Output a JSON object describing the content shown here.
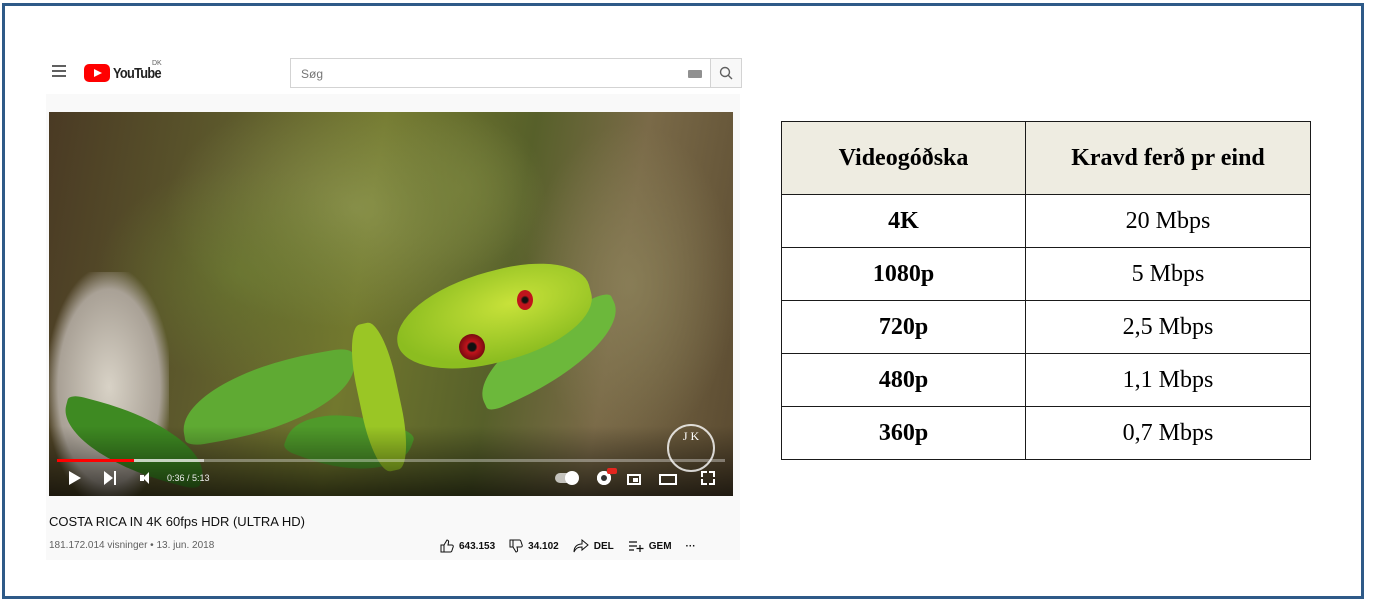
{
  "youtube": {
    "logo_text": "YouTube",
    "country_code": "DK",
    "search": {
      "placeholder": "Søg"
    },
    "player": {
      "time": "0:36 / 5:13",
      "progress": 0.115,
      "buffered": 0.22
    },
    "video": {
      "title": "COSTA RICA IN 4K 60fps HDR (ULTRA HD)",
      "meta": "181.172.014 visninger • 13. jun. 2018",
      "likes": "643.153",
      "dislikes": "34.102",
      "share_label": "DEL",
      "save_label": "GEM",
      "more_label": "···"
    },
    "watermark": "J K"
  },
  "table": {
    "headers": [
      "Videogóðska",
      "Kravd ferð pr eind"
    ],
    "rows": [
      {
        "quality": "4K",
        "speed": "20 Mbps"
      },
      {
        "quality": "1080p",
        "speed": "5 Mbps"
      },
      {
        "quality": "720p",
        "speed": "2,5 Mbps"
      },
      {
        "quality": "480p",
        "speed": "1,1 Mbps"
      },
      {
        "quality": "360p",
        "speed": "0,7 Mbps"
      }
    ]
  },
  "colors": {
    "frame_border": "#2e5a88",
    "youtube_red": "#ff0000",
    "table_header_bg": "#eeece1"
  }
}
